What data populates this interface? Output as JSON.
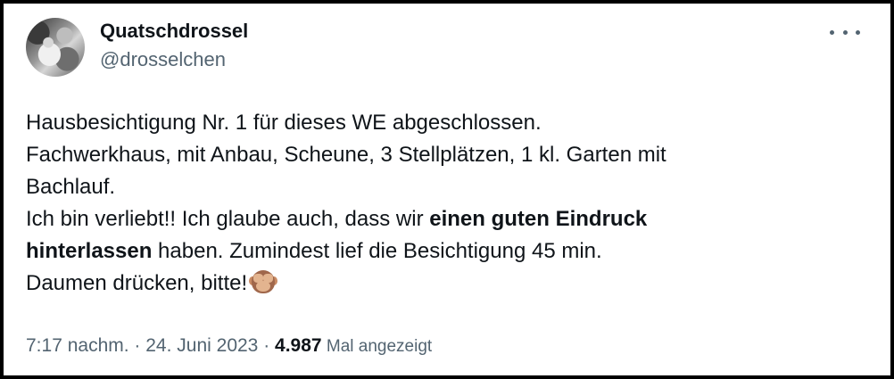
{
  "author": {
    "display_name": "Quatschdrossel",
    "handle": "@drosselchen",
    "avatar_icon": "profile-photo"
  },
  "menu": {
    "icon": "more-horizontal-icon"
  },
  "text": {
    "l1": "Hausbesichtigung Nr. 1 für dieses WE abgeschlossen.",
    "l2": "Fachwerkhaus, mit Anbau, Scheune, 3 Stellplätzen, 1 kl. Garten mit",
    "l3": "Bachlauf.",
    "l4_pre": "Ich bin verliebt!! Ich glaube auch, dass wir ",
    "l4_bold": "einen guten Eindruck",
    "l5_bold": "hinterlassen",
    "l5_post": " haben. Zumindest lief die Besichtigung 45 min.",
    "l6": "Daumen drücken, bitte!",
    "emoji": "see-no-evil-monkey"
  },
  "meta": {
    "time": "7:17 nachm.",
    "sep1": " · ",
    "date": "24. Juni 2023",
    "sep2": " · ",
    "views_count": "4.987",
    "views_label": " Mal angezeigt"
  },
  "colors": {
    "text": "#0f1419",
    "secondary": "#536471",
    "border": "#000000",
    "background": "#ffffff"
  }
}
